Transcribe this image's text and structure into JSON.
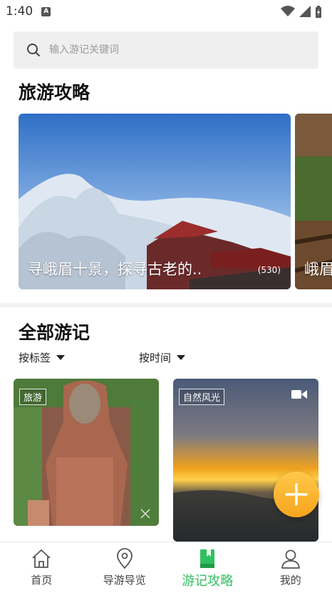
{
  "status_bar": {
    "time": "1:40",
    "notification_badge": "A"
  },
  "search": {
    "placeholder": "输入游记关键词"
  },
  "guides_section": {
    "title": "旅游攻略",
    "cards": [
      {
        "caption": "寻峨眉十景，探寻古老的..",
        "count": "(530)"
      },
      {
        "caption": "峨眉"
      }
    ]
  },
  "notes_section": {
    "title": "全部游记",
    "filters": {
      "by_tag": "按标签",
      "by_time": "按时间"
    },
    "cards": [
      {
        "tag": "旅游",
        "media": "image"
      },
      {
        "tag": "自然风光",
        "media": "video"
      }
    ]
  },
  "fab": {
    "icon": "plus-icon"
  },
  "bottom_nav": {
    "items": [
      {
        "label": "首页",
        "icon": "home-icon",
        "active": false
      },
      {
        "label": "导游导览",
        "icon": "location-pin-icon",
        "active": false
      },
      {
        "label": "游记攻略",
        "icon": "book-icon",
        "active": true
      },
      {
        "label": "我的",
        "icon": "user-icon",
        "active": false
      }
    ],
    "active_color": "#2fc15f"
  },
  "colors": {
    "accent": "#2fc15f",
    "fab": "#f6a41c"
  }
}
